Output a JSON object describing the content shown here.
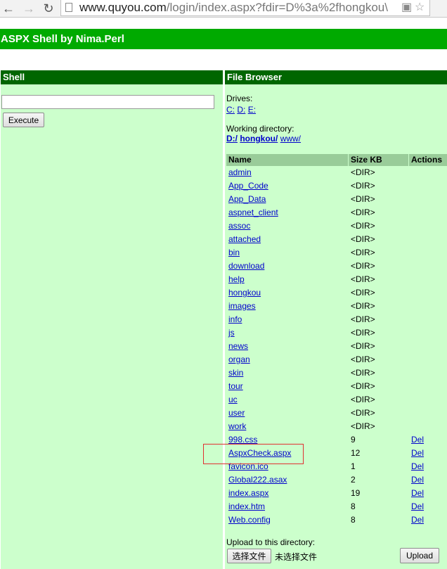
{
  "browser": {
    "url_host": "www.quyou.com",
    "url_path": "/login/index.aspx?fdir=D%3a%2fhongkou\\"
  },
  "app": {
    "title": "ASPX Shell by Nima.Perl"
  },
  "shell": {
    "header": "Shell",
    "command_value": "",
    "execute_label": "Execute"
  },
  "browser_panel": {
    "header": "File Browser",
    "drives_label": "Drives:",
    "drives": [
      "C:",
      "D:",
      "E:"
    ],
    "working_dir_label": "Working directory:",
    "working_dir": [
      "D:/",
      "hongkou/",
      "www/"
    ],
    "columns": [
      "Name",
      "Size KB",
      "Actions"
    ],
    "entries": [
      {
        "name": "admin",
        "size": "<DIR>",
        "action": ""
      },
      {
        "name": "App_Code",
        "size": "<DIR>",
        "action": ""
      },
      {
        "name": "App_Data",
        "size": "<DIR>",
        "action": ""
      },
      {
        "name": "aspnet_client",
        "size": "<DIR>",
        "action": ""
      },
      {
        "name": "assoc",
        "size": "<DIR>",
        "action": ""
      },
      {
        "name": "attached",
        "size": "<DIR>",
        "action": ""
      },
      {
        "name": "bin",
        "size": "<DIR>",
        "action": ""
      },
      {
        "name": "download",
        "size": "<DIR>",
        "action": ""
      },
      {
        "name": "help",
        "size": "<DIR>",
        "action": ""
      },
      {
        "name": "hongkou",
        "size": "<DIR>",
        "action": ""
      },
      {
        "name": "images",
        "size": "<DIR>",
        "action": ""
      },
      {
        "name": "info",
        "size": "<DIR>",
        "action": ""
      },
      {
        "name": "js",
        "size": "<DIR>",
        "action": ""
      },
      {
        "name": "news",
        "size": "<DIR>",
        "action": ""
      },
      {
        "name": "organ",
        "size": "<DIR>",
        "action": ""
      },
      {
        "name": "skin",
        "size": "<DIR>",
        "action": ""
      },
      {
        "name": "tour",
        "size": "<DIR>",
        "action": ""
      },
      {
        "name": "uc",
        "size": "<DIR>",
        "action": ""
      },
      {
        "name": "user",
        "size": "<DIR>",
        "action": ""
      },
      {
        "name": "work",
        "size": "<DIR>",
        "action": ""
      },
      {
        "name": "998.css",
        "size": "9",
        "action": "Del"
      },
      {
        "name": "AspxCheck.aspx",
        "size": "12",
        "action": "Del"
      },
      {
        "name": "favicon.ico",
        "size": "1",
        "action": "Del"
      },
      {
        "name": "Global222.asax",
        "size": "2",
        "action": "Del"
      },
      {
        "name": "index.aspx",
        "size": "19",
        "action": "Del"
      },
      {
        "name": "index.htm",
        "size": "8",
        "action": "Del"
      },
      {
        "name": "Web.config",
        "size": "8",
        "action": "Del"
      }
    ],
    "upload_label": "Upload to this directory:",
    "choose_file_label": "选择文件",
    "no_file_label": "未选择文件",
    "upload_button": "Upload"
  }
}
